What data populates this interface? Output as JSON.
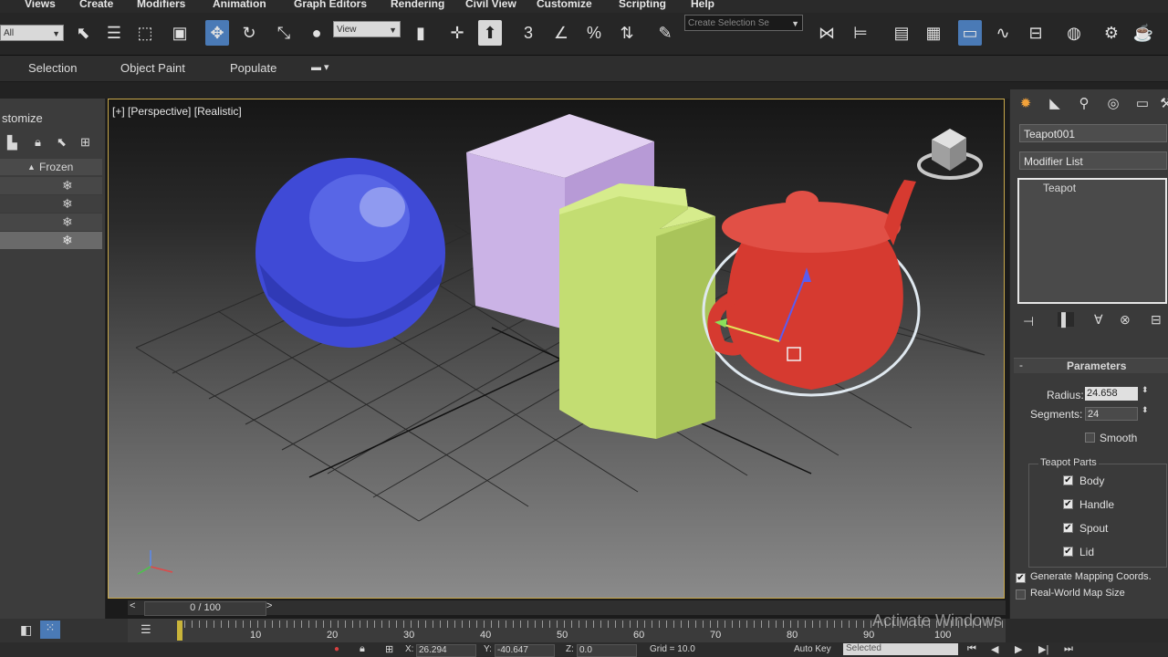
{
  "menu": [
    "Views",
    "Create",
    "Modifiers",
    "Animation",
    "Graph Editors",
    "Rendering",
    "Civil View",
    "Customize",
    "Scripting",
    "Help"
  ],
  "toolbar": {
    "filter_value": "All",
    "ref_coord_value": "View",
    "named_selection_placeholder": "Create Selection Se"
  },
  "ribbon": {
    "tabs": [
      "Selection",
      "Object Paint",
      "Populate"
    ]
  },
  "explorer": {
    "title": "stomize",
    "column_header": "Frozen",
    "rows": 4
  },
  "viewport": {
    "label_plus": "[+]",
    "label_view": "[Perspective]",
    "label_shading": "[Realistic]"
  },
  "command_panel": {
    "object_name": "Teapot001",
    "modifier_list": "Modifier List",
    "stack_item": "Teapot",
    "rollout_title": "Parameters",
    "radius_label": "Radius:",
    "radius_value": "24.658",
    "segments_label": "Segments:",
    "segments_value": "24",
    "smooth_label": "Smooth",
    "parts_group": "Teapot Parts",
    "parts": [
      {
        "label": "Body",
        "checked": true
      },
      {
        "label": "Handle",
        "checked": true
      },
      {
        "label": "Spout",
        "checked": true
      },
      {
        "label": "Lid",
        "checked": true
      }
    ],
    "gen_mapping": "Generate Mapping Coords.",
    "real_world": "Real-World Map Size"
  },
  "timeline": {
    "frame_counter": "0 / 100",
    "ticks": [
      "10",
      "20",
      "30",
      "40",
      "50",
      "60",
      "70",
      "80",
      "90",
      "100"
    ]
  },
  "status": {
    "x_value": "26.294",
    "y_value": "-40.647",
    "z_value": "0.0",
    "grid": "Grid = 10.0",
    "auto_key": "Auto Key",
    "selected": "Selected",
    "watermark": "Activate Windows"
  }
}
